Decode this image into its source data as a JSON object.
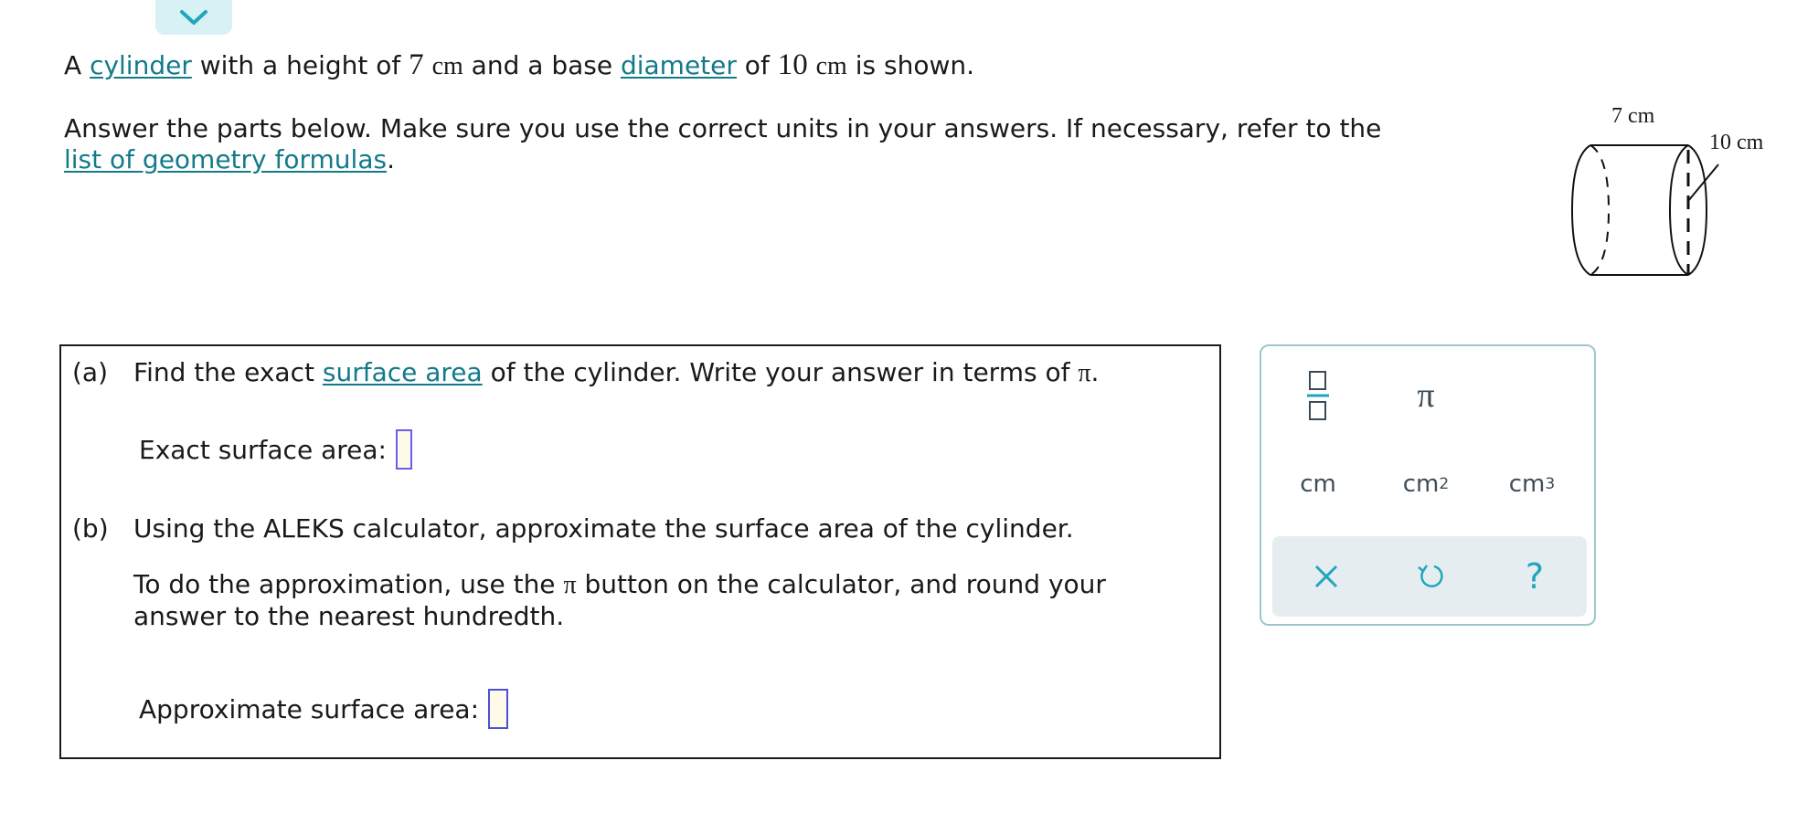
{
  "intro": {
    "l1_a": "A ",
    "l1_link_cylinder": "cylinder",
    "l1_b": " with a height of ",
    "height_value": "7",
    "height_unit": "cm",
    "l1_c": " and a base ",
    "l1_link_diameter": "diameter",
    "l1_d": " of ",
    "diameter_value": "10",
    "diameter_unit": "cm",
    "l1_e": " is shown.",
    "p2_text": "Answer the parts below. Make sure you use the correct units in your answers. If necessary, refer to the",
    "p2_link": "list of geometry formulas",
    "p2_end": "."
  },
  "figure": {
    "height_label": "7 cm",
    "diameter_label": "10 cm"
  },
  "part_a": {
    "tag": "(a)",
    "text_1": "Find the exact ",
    "link": "surface area",
    "text_2": " of the cylinder. Write your answer in terms of ",
    "pi": "π",
    "text_3": ".",
    "answer_label": "Exact surface area:"
  },
  "part_b": {
    "tag": "(b)",
    "text_1": "Using the ALEKS calculator, approximate the surface area of the cylinder.",
    "text_2a": "To do the approximation, use the ",
    "pi": "π",
    "text_2b": " button on the calculator, and round your",
    "text_3": "answer to the nearest hundredth.",
    "answer_label": "Approximate surface area:"
  },
  "keypad": {
    "pi_key": "π",
    "unit_cm": "cm",
    "unit_cm2_base": "cm",
    "unit_cm2_exp": "2",
    "unit_cm3_base": "cm",
    "unit_cm3_exp": "3",
    "help_key": "?"
  },
  "colors": {
    "link": "#137a8a",
    "input_border": "#4b4fd6",
    "input_bg": "#fdfbe7",
    "keypad_border": "#9fc6cd",
    "keypad_tools_bg": "#e6edf0",
    "collapse_tab_bg": "#d8f1f4"
  },
  "icons": {
    "collapse": "chevron-down-icon",
    "fraction": "fraction-icon",
    "clear": "x-icon",
    "undo": "undo-icon"
  }
}
